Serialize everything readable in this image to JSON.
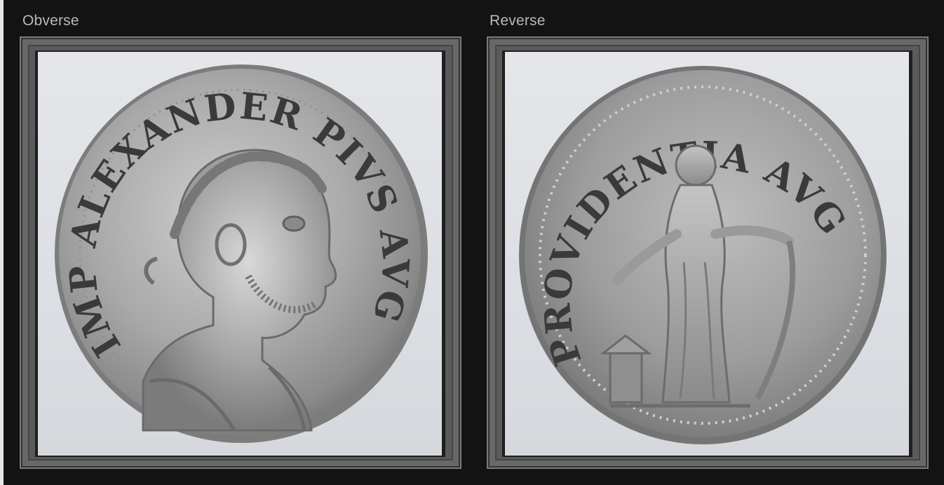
{
  "panels": [
    {
      "label": "Obverse",
      "image": "coin-obverse-image",
      "legend": "IMP ALEXANDER PIVS AVG"
    },
    {
      "label": "Reverse",
      "image": "coin-reverse-image",
      "legend": "PROVIDENTIA AVG"
    }
  ],
  "colors": {
    "background": "#131313",
    "label": "#b9b9b9",
    "frame": "#5b5b5b",
    "photo_background": "#e1e3e7",
    "silver_light": "#c9c9c9",
    "silver_dark": "#6f6f6f"
  }
}
